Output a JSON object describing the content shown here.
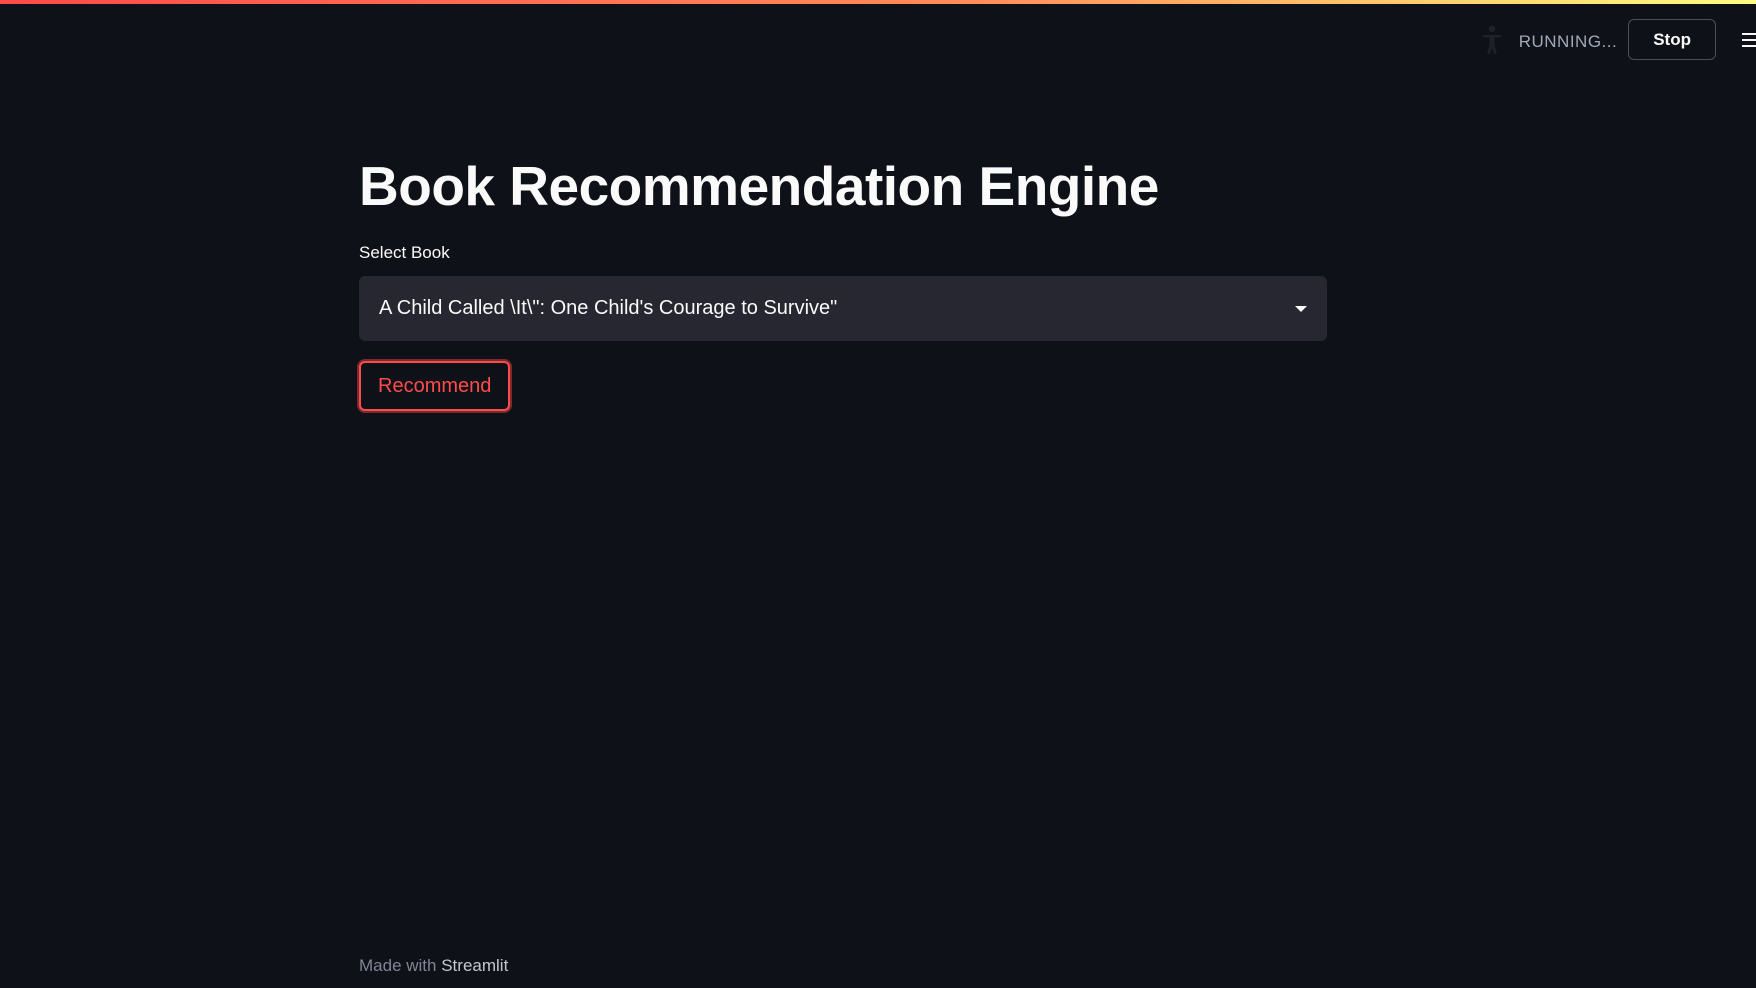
{
  "colors": {
    "background": "#0e1117",
    "accent": "#ff4b4b",
    "select_background": "#262730",
    "text": "#fafafa"
  },
  "header": {
    "status_icon": "running-man-icon",
    "status_text": "RUNNING...",
    "stop_label": "Stop",
    "menu_icon": "hamburger-menu-icon"
  },
  "main": {
    "title": "Book Recommendation Engine",
    "select_label": "Select Book",
    "selected_book": "A Child Called \\It\\\": One Child's Courage to Survive\"",
    "recommend_label": "Recommend"
  },
  "footer": {
    "prefix": "Made with",
    "link": "Streamlit"
  }
}
